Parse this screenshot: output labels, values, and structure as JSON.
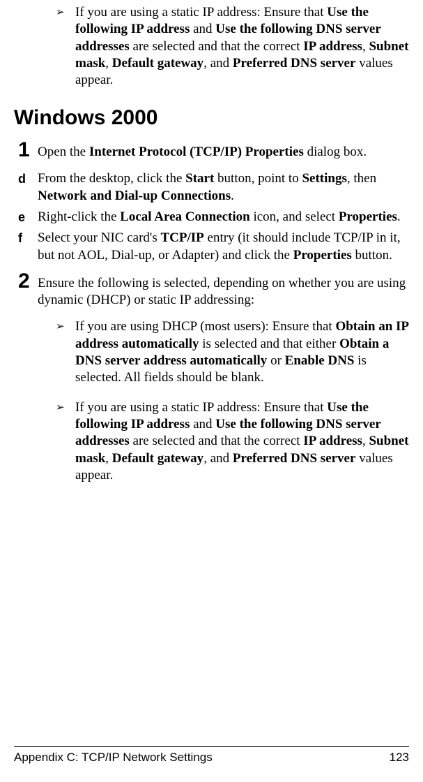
{
  "intro_bullet": {
    "marker": "➢",
    "pre": "If you are using a static IP address: Ensure that ",
    "b1": "Use the following IP address",
    "mid1": " and ",
    "b2": "Use the following DNS server addresses",
    "mid2": " are selected and that the correct ",
    "b3": "IP address",
    "c1": ", ",
    "b4": "Subnet mask",
    "c2": ", ",
    "b5": "Default gateway",
    "c3": ", and ",
    "b6": "Preferred DNS server",
    "post": " values appear."
  },
  "heading": "Windows 2000",
  "step1": {
    "num": "1",
    "pre": "Open the ",
    "b1": "Internet Protocol (TCP/IP) Properties",
    "post": " dialog box."
  },
  "sub_d": {
    "letter": "d",
    "t1": "From the desktop, click the ",
    "b1": "Start",
    "t2": " button, point to ",
    "b2": "Settings",
    "t3": ", then ",
    "b3": "Network and Dial-up Connections",
    "t4": "."
  },
  "sub_e": {
    "letter": "e",
    "t1": "Right-click the ",
    "b1": "Local Area Connection",
    "t2": " icon, and select ",
    "b2": "Properties",
    "t3": "."
  },
  "sub_f": {
    "letter": "f",
    "t1": "Select your NIC card's ",
    "b1": "TCP/IP",
    "t2": " entry (it should include TCP/IP in it, but not AOL, Dial-up, or Adapter) and click the ",
    "b2": "Properties",
    "t3": " button."
  },
  "step2": {
    "num": "2",
    "text": "Ensure the following is selected, depending on whether you are using dynamic (DHCP) or static IP addressing:"
  },
  "bullet_dhcp": {
    "marker": "➢",
    "t1": "If you are using DHCP (most users): Ensure that ",
    "b1": "Obtain an IP address automatically",
    "t2": " is selected and that either ",
    "b2": "Obtain a DNS server address automatically",
    "t3": " or ",
    "b3": "Enable DNS",
    "t4": " is selected. All fields should be blank."
  },
  "bullet_static": {
    "marker": "➢",
    "pre": "If you are using a static IP address: Ensure that ",
    "b1": "Use the following IP address",
    "mid1": " and ",
    "b2": "Use the following DNS server addresses",
    "mid2": " are selected and that the correct ",
    "b3": "IP address",
    "c1": ", ",
    "b4": "Subnet mask",
    "c2": ", ",
    "b5": "Default gateway",
    "c3": ", and ",
    "b6": "Preferred DNS server",
    "post": " values appear."
  },
  "footer": {
    "left": "Appendix C: TCP/IP Network Settings",
    "right": "123"
  }
}
